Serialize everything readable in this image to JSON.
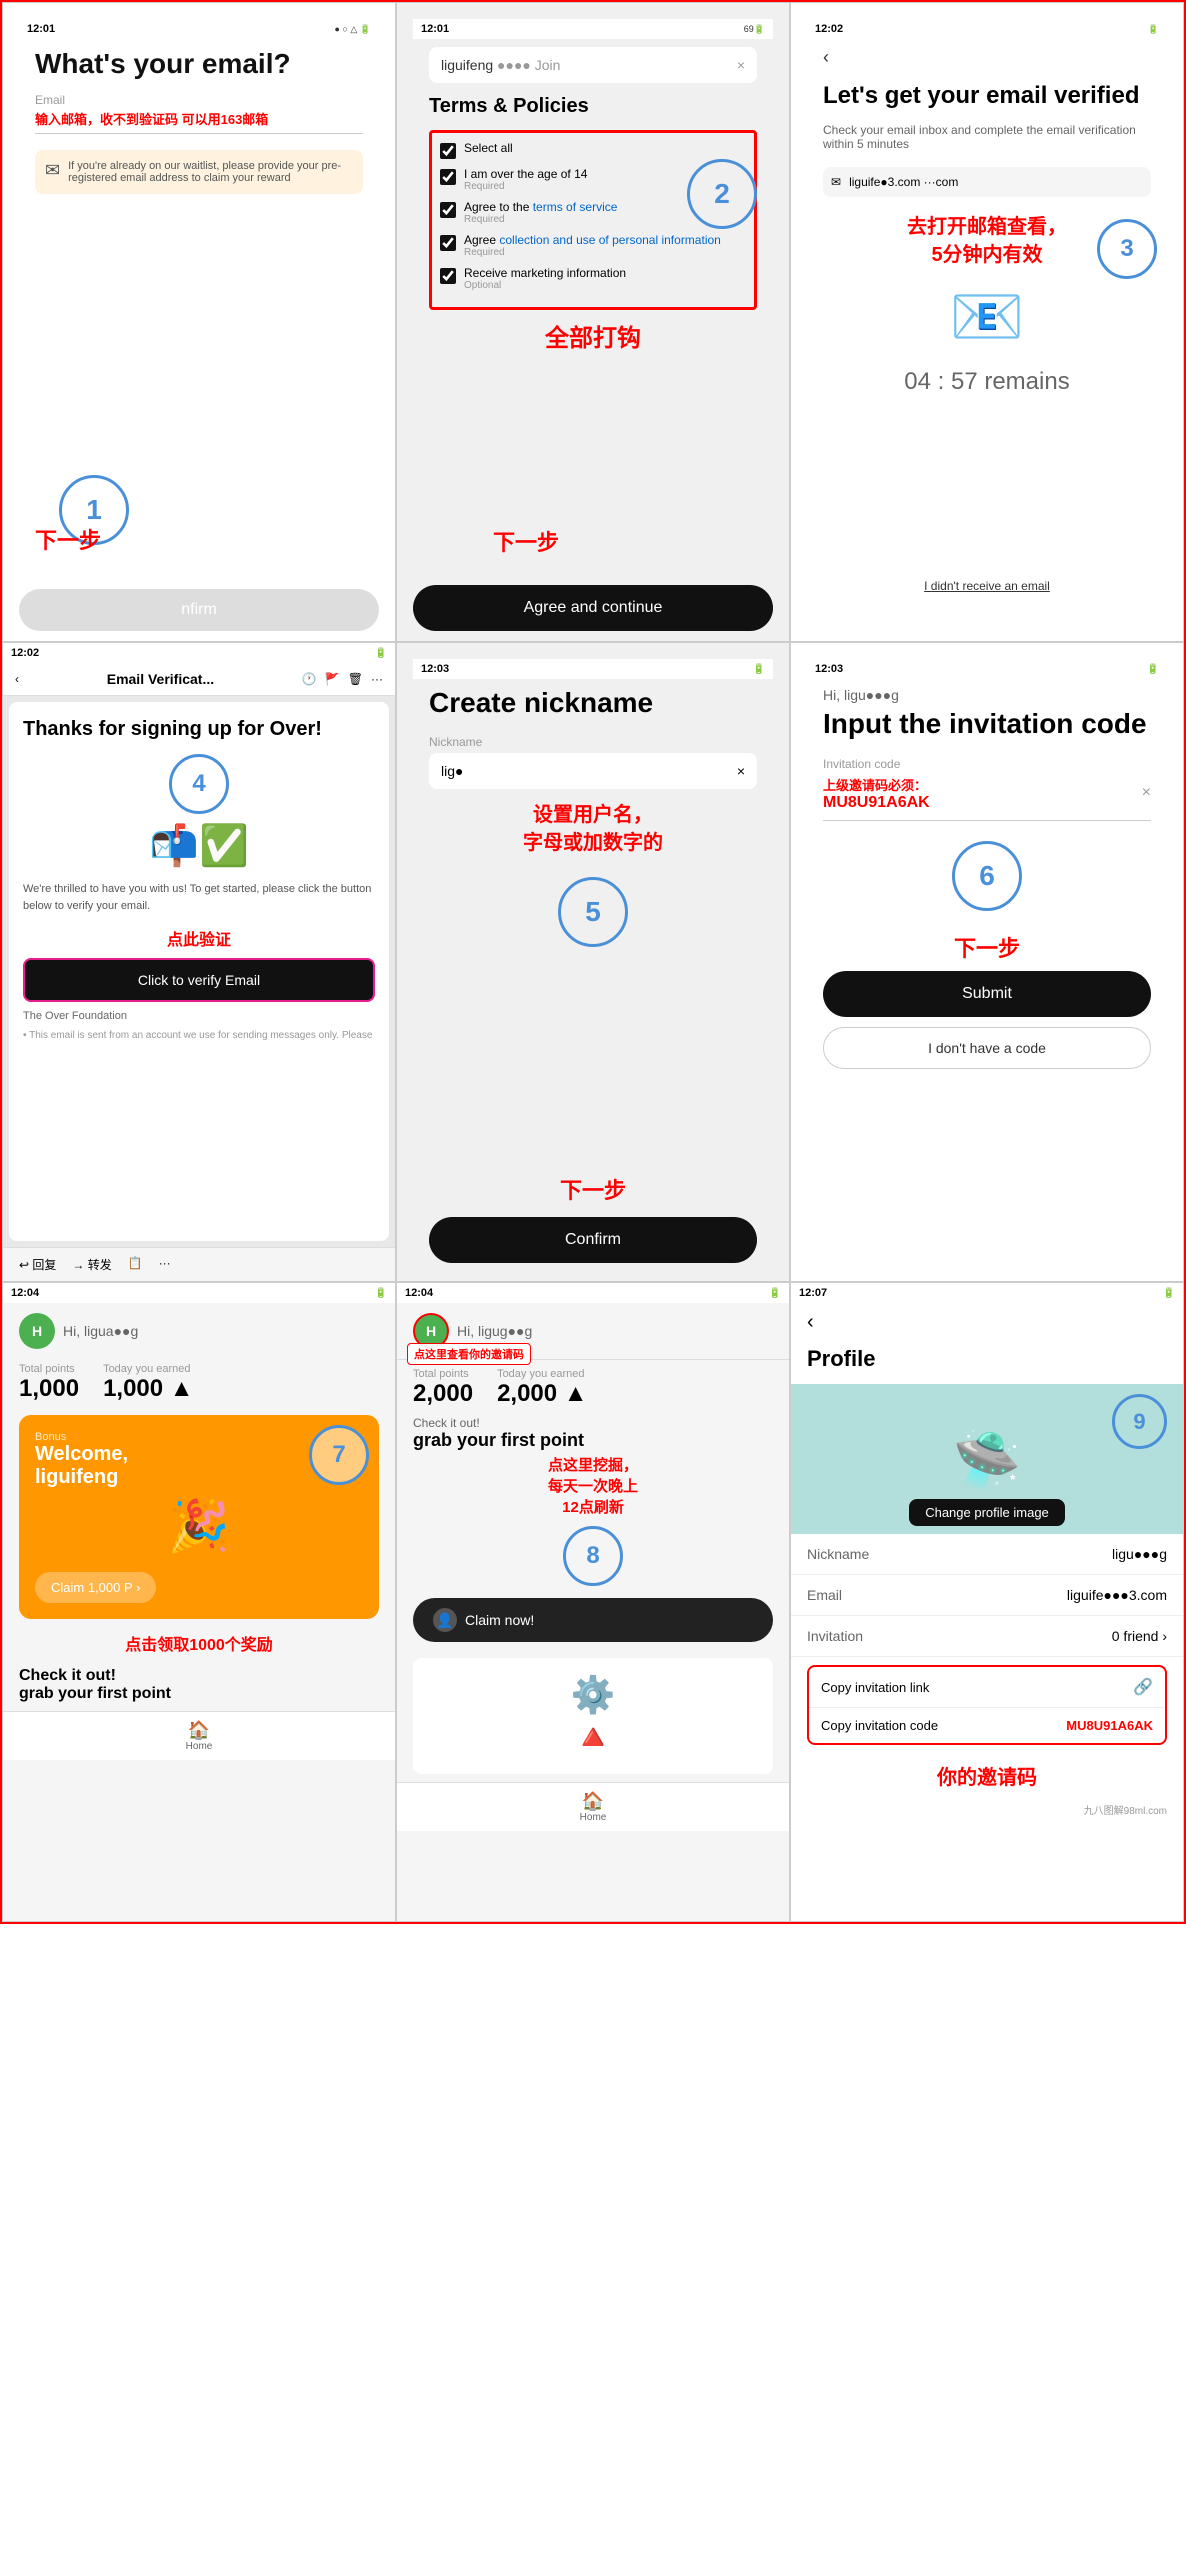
{
  "app": {
    "title": "Over App Registration Tutorial"
  },
  "cells": [
    {
      "id": "cell1",
      "statusBar": {
        "time": "12:01",
        "icons": "● ○ △ 🔋"
      },
      "title": "What's your email?",
      "emailLabel": "Email",
      "redText": "输入邮箱，收不到验证码\n可以用163邮箱",
      "noticeText": "If you're already on our waitlist, please provide your pre-registered email address to claim your reward",
      "stepNumber": "1",
      "nextLabel": "下一步",
      "btnText": "nfirm"
    },
    {
      "id": "cell2",
      "statusBar": {
        "time": "12:01",
        "icons": "69🔋"
      },
      "emailValue": "liguifeng",
      "termsTitle": "Terms & Policies",
      "checkboxes": [
        {
          "label": "Select all",
          "required": false,
          "checked": true
        },
        {
          "label": "I am over the age of 14",
          "required": true,
          "checked": true
        },
        {
          "label": "Agree to the terms of service",
          "required": true,
          "checked": true,
          "hasLink": true
        },
        {
          "label": "Agree collection and use of personal information",
          "required": true,
          "checked": true,
          "hasLink": true
        },
        {
          "label": "Receive marketing information",
          "required": false,
          "checked": true
        }
      ],
      "redLabel": "全部打钩",
      "stepNumber": "2",
      "nextLabel": "下一步",
      "agreeBtnText": "Agree and continue"
    },
    {
      "id": "cell3",
      "statusBar": {
        "time": "12:02",
        "icons": "🔋"
      },
      "title": "Let's get your email verified",
      "subtitle": "Check your email inbox and complete the email verification within 5 minutes",
      "emailDisplay": "liguife●3.com ···com",
      "redText": "去打开邮箱查看，\n5分钟内有效",
      "stepNumber": "3",
      "timer": "04 : 57  remains",
      "resendText": "I didn't receive an email"
    },
    {
      "id": "cell4",
      "statusBar": {
        "time": "12:02",
        "icons": "🔋"
      },
      "emailNavTitle": "Email Verificat...",
      "title": "Thanks for signing up for Over!",
      "bodyText": "We're thrilled to have you with us! To get started, please click the button below to verify your email.",
      "verifyLabel": "点此验证",
      "verifyBtnText": "Click to verify Email",
      "foundation": "The Over Foundation",
      "disclaimer": "• This email is sent from an account we use for sending messages only. Please",
      "stepNumber": "4",
      "actionButtons": [
        "回复",
        "转发"
      ]
    },
    {
      "id": "cell5",
      "statusBar": {
        "time": "12:03",
        "icons": "🔋"
      },
      "title": "Create nickname",
      "nickLabel": "Nickname",
      "nickValue": "lig●",
      "redText": "设置用户名，\n字母或加数字的",
      "stepNumber": "5",
      "nextLabel": "下一步",
      "confirmBtnText": "Confirm"
    },
    {
      "id": "cell6",
      "statusBar": {
        "time": "12:03",
        "icons": "🔋"
      },
      "hiText": "Hi, ligu●●●g",
      "title": "Input the invitation code",
      "invLabel": "Invitation code",
      "invNote": "上级邀请码必须：",
      "invCode": "MU8U91A6AK",
      "stepNumber": "6",
      "nextLabel": "下一步",
      "submitBtnText": "Submit",
      "noCodeBtnText": "I don't have a code"
    },
    {
      "id": "cell7",
      "statusBar": {
        "time": "12:04",
        "icons": "🔋"
      },
      "greeting": "Hi, ligua●●g",
      "stats": [
        {
          "label": "Total points",
          "value": "1,000"
        },
        {
          "label": "Today you earned",
          "value": "1,000 ▲"
        }
      ],
      "bonusLabel": "Bonus",
      "welcomeText": "Welcome,\nliguifeng",
      "claimBtnText": "Claim 1,000 P  ›",
      "redText": "点击领取1000个奖励",
      "stepNumber": "7",
      "sectionText": "Check it out!\ngrab your first point",
      "homeTab": "Home"
    },
    {
      "id": "cell8",
      "statusBar": {
        "time": "12:04",
        "icons": "🔋"
      },
      "greeting": "Hi, ligug●●g",
      "avatarNote": "点这里查看你的邀请码",
      "stats": [
        {
          "label": "Total points",
          "value": "2,000"
        },
        {
          "label": "Today you earned",
          "value": "2,000 ▲"
        }
      ],
      "sectionText": "Check it out!\ngrab your first point",
      "redText": "点这里挖掘，\n每天一次晚上\n12点刷新",
      "stepNumber": "8",
      "claimText": "Claim now!",
      "noticeGear": "⚙",
      "noticeCone": "🔺",
      "homeTab": "Home"
    },
    {
      "id": "cell9",
      "statusBar": {
        "time": "12:07",
        "icons": "🔋"
      },
      "profileTitle": "Profile",
      "changeImgBtn": "Change profile image",
      "stepNumber": "9",
      "rows": [
        {
          "label": "Nickname",
          "value": "ligu●●●g"
        },
        {
          "label": "Email",
          "value": "liguife●●●3.com"
        },
        {
          "label": "Invitation",
          "value": "0 friend  ›"
        }
      ],
      "invActions": [
        {
          "label": "Copy invitation link",
          "icon": "🔗"
        },
        {
          "label": "Copy invitation code",
          "value": "MU8U91A6AK"
        }
      ],
      "yourCodeLabel": "你的邀请码",
      "watermark": "九八图解98ml.com"
    }
  ]
}
